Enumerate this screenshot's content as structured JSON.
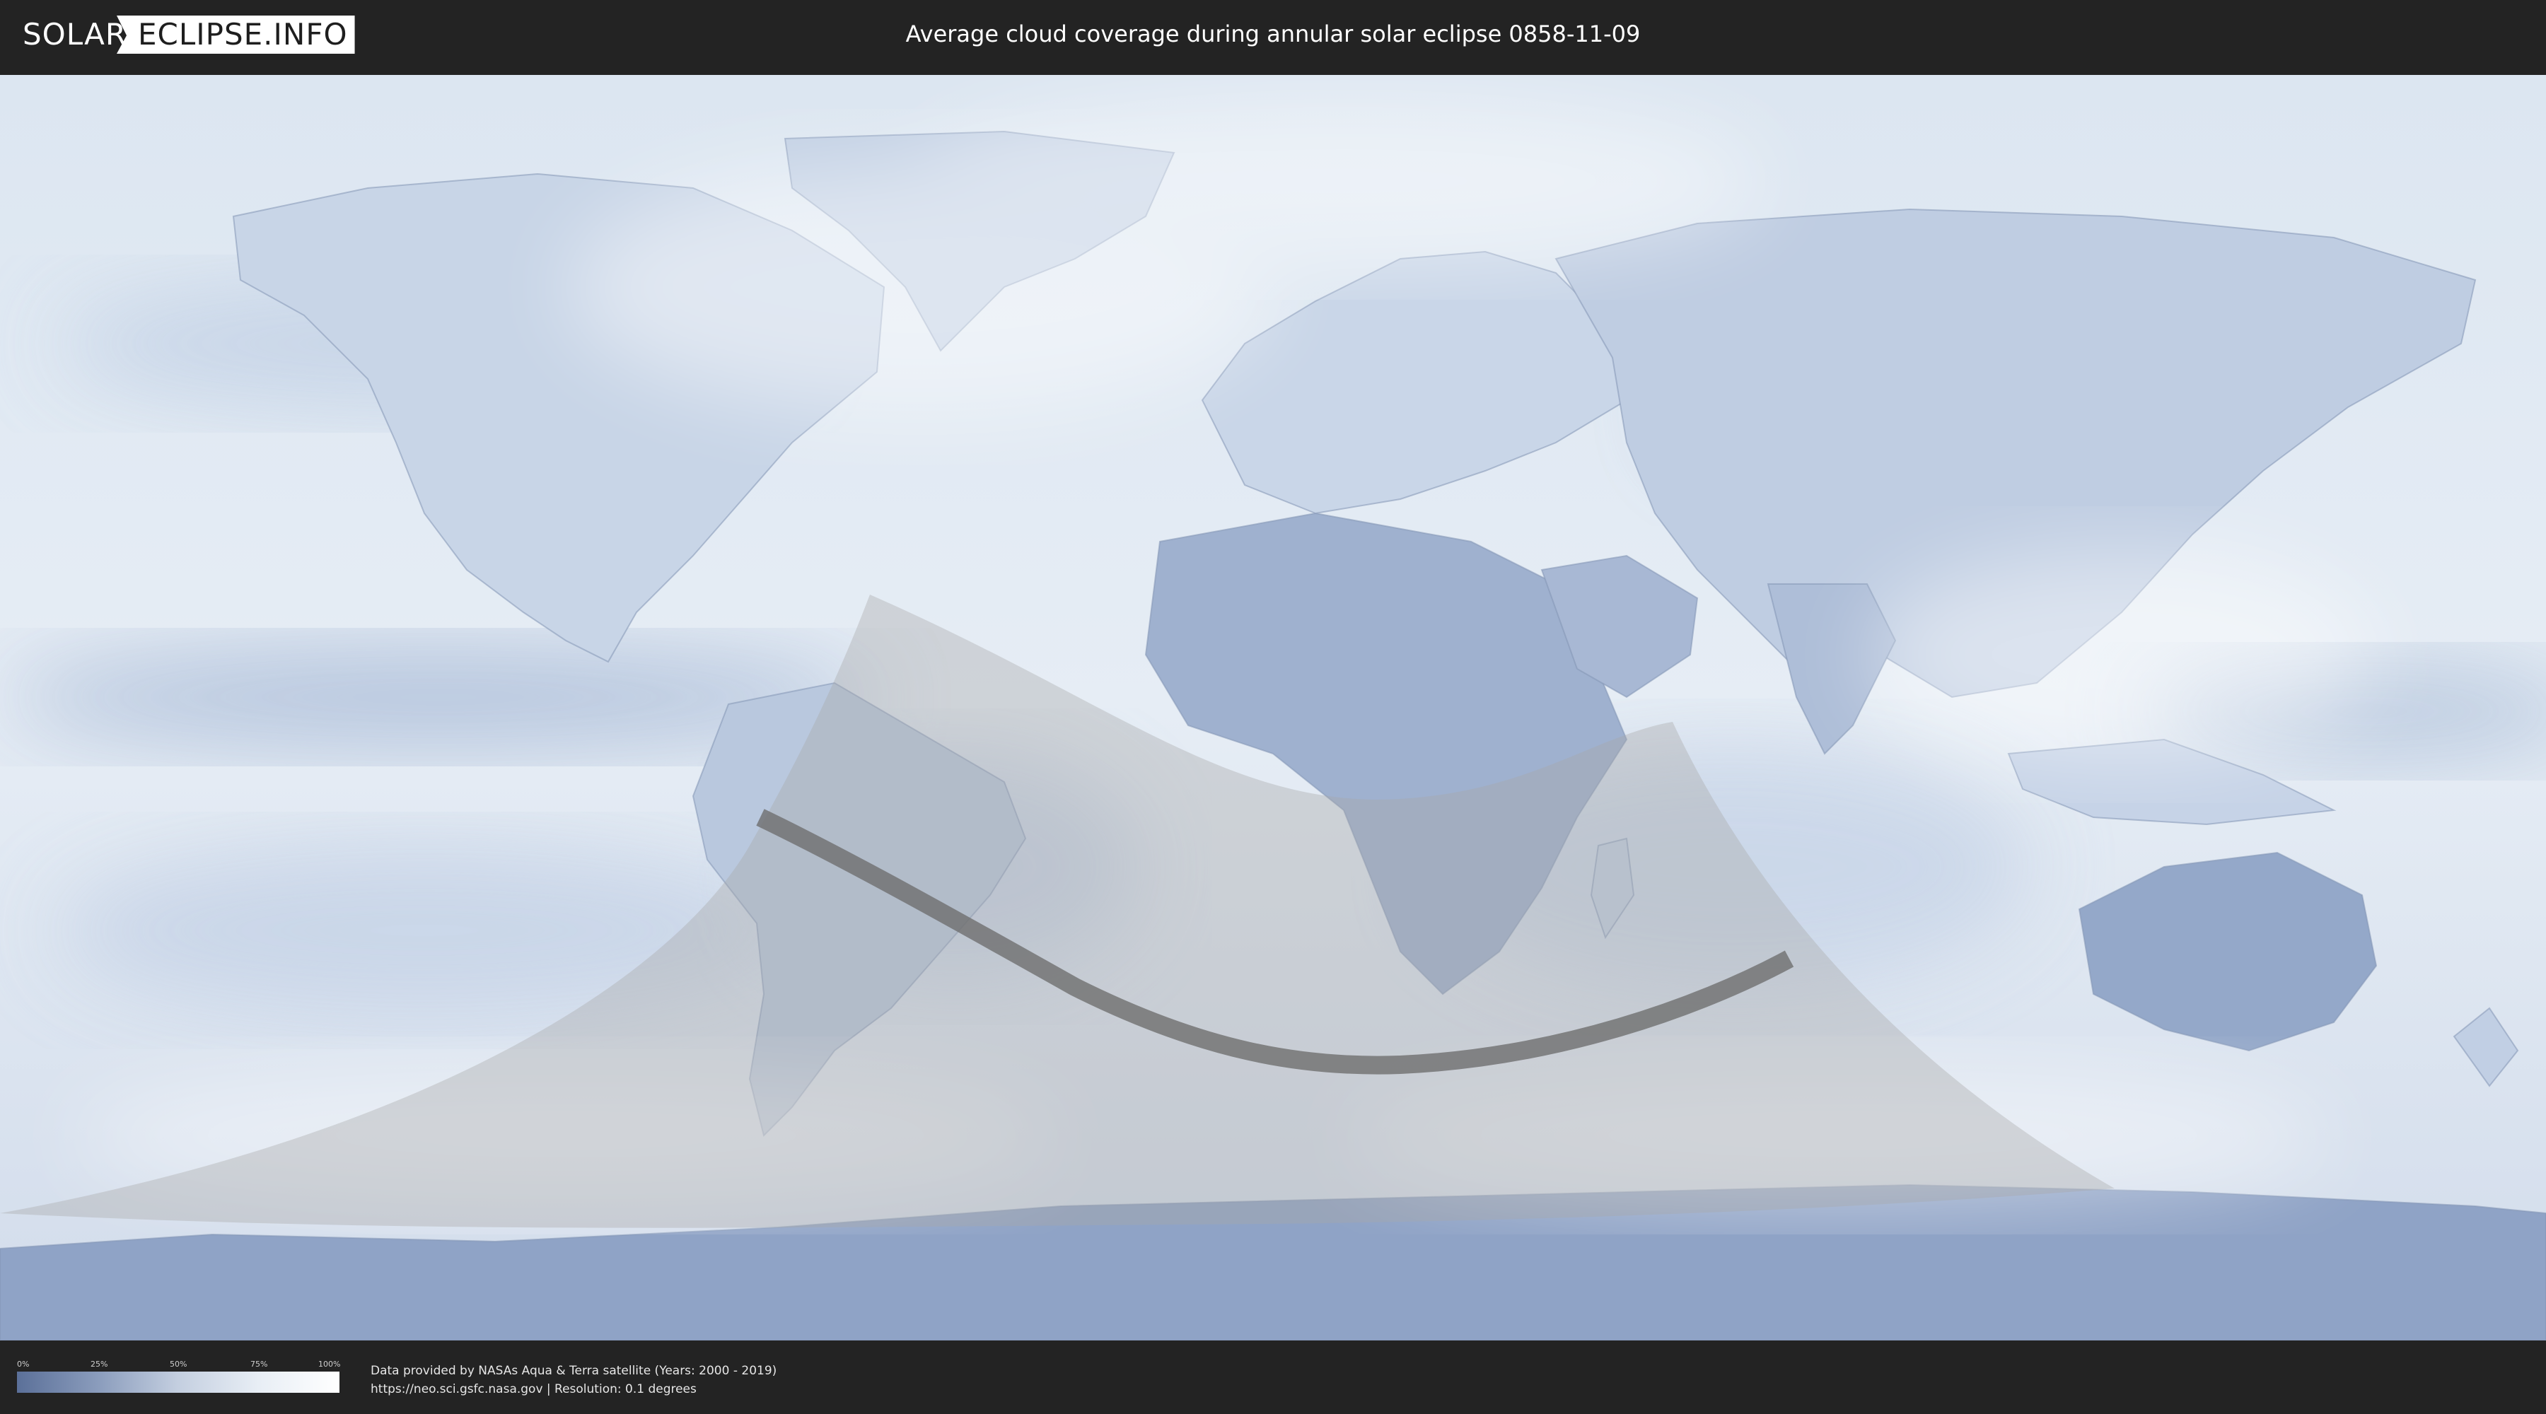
{
  "header": {
    "logo_part1": "SOLAR",
    "logo_part2": "ECLIPSE.INFO",
    "title": "Average cloud coverage during annular solar eclipse 0858-11-09"
  },
  "map": {
    "projection": "equirectangular",
    "layers": [
      "cloud-coverage",
      "country-borders",
      "penumbra-region",
      "annularity-path"
    ],
    "colors": {
      "cloud_low": "#5b7099",
      "cloud_high": "#ffffff",
      "penumbra_shade": "#b4b4b4",
      "annular_path": "#6e6e6e"
    }
  },
  "legend": {
    "ticks": [
      "0%",
      "25%",
      "50%",
      "75%",
      "100%"
    ],
    "gradient_colors": [
      "#5b7099",
      "#8a9cbc",
      "#c4cfe0",
      "#e8eef5",
      "#ffffff"
    ]
  },
  "footer": {
    "credit_line1": "Data provided by NASAs Aqua & Terra satellite (Years: 2000 - 2019)",
    "credit_line2": "https://neo.sci.gsfc.nasa.gov | Resolution: 0.1 degrees"
  }
}
